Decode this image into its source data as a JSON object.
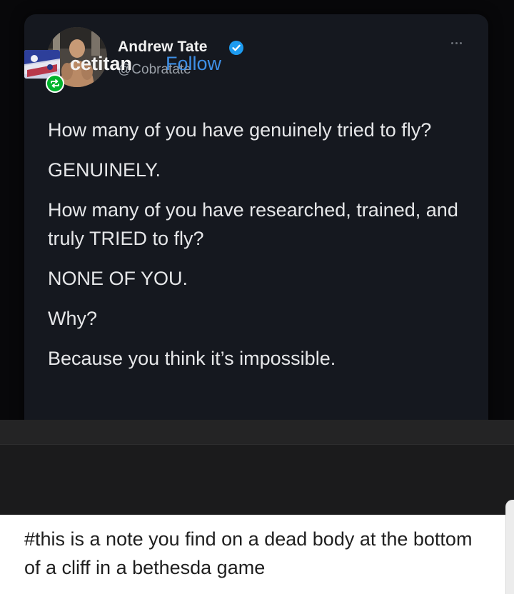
{
  "tweet": {
    "author_name": "Andrew Tate",
    "handle": "@Cobratate",
    "paragraphs": [
      "How many of you have genuinely tried to fly?",
      "GENUINELY.",
      "How many of you have researched, trained, and truly TRIED to fly?",
      "NONE OF YOU.",
      "Why?",
      "Because you think it’s impossible."
    ]
  },
  "post": {
    "blog_name": "cetitan",
    "follow_label": "Follow",
    "caption": "#this is a note you find on a dead body at the bottom of a cliff in a bethesda game"
  },
  "icons": {
    "verified": "verified-badge-icon",
    "more": "more-options-icon",
    "reblog": "reblog-icon"
  },
  "colors": {
    "card_bg": "#15181f",
    "verified_blue": "#1d9bf0",
    "follow_blue": "#3e8fe6",
    "reblog_green": "#00b32c"
  }
}
